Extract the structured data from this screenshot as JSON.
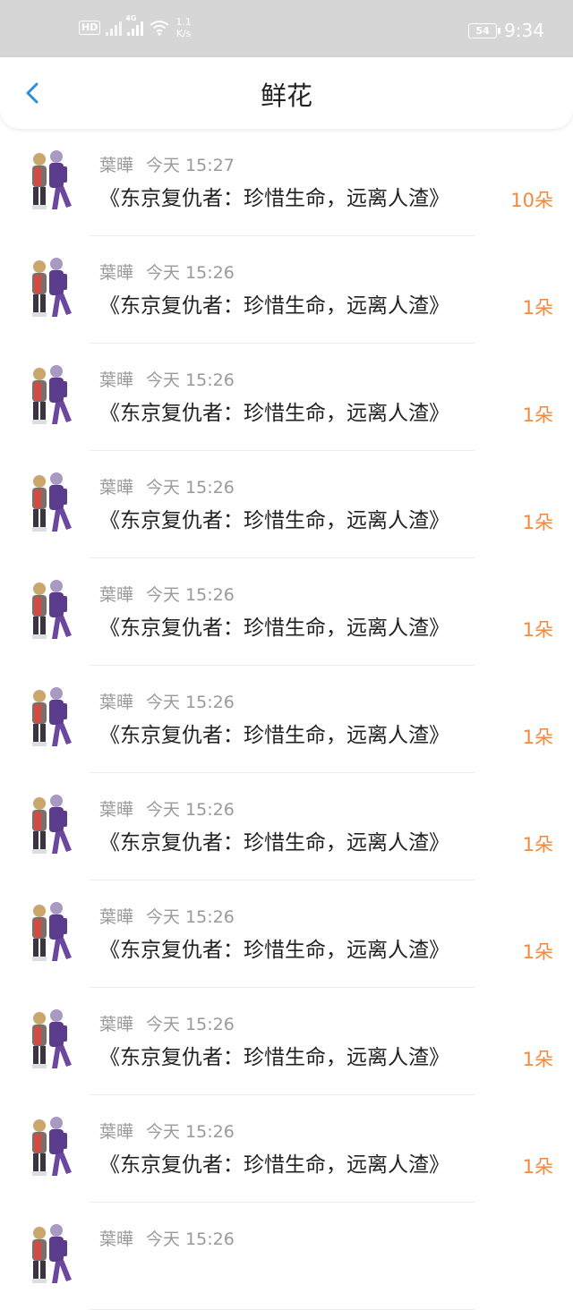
{
  "status_bar": {
    "hd": "HD",
    "network": "4G",
    "speed_value": "1.1",
    "speed_unit": "K/s",
    "battery": "54",
    "time": "9:34"
  },
  "nav": {
    "back_icon": "chevron-left-icon",
    "title": "鲜花"
  },
  "colors": {
    "accent": "#2a8fd8",
    "count": "#f08a3e",
    "meta": "#9a9a9a",
    "status_bar_bg": "#d6d6d6"
  },
  "records": [
    {
      "user": "葉曄",
      "time": "今天 15:27",
      "title": "《东京复仇者：珍惜生命，远离人渣》",
      "count": "10朵"
    },
    {
      "user": "葉曄",
      "time": "今天 15:26",
      "title": "《东京复仇者：珍惜生命，远离人渣》",
      "count": "1朵"
    },
    {
      "user": "葉曄",
      "time": "今天 15:26",
      "title": "《东京复仇者：珍惜生命，远离人渣》",
      "count": "1朵"
    },
    {
      "user": "葉曄",
      "time": "今天 15:26",
      "title": "《东京复仇者：珍惜生命，远离人渣》",
      "count": "1朵"
    },
    {
      "user": "葉曄",
      "time": "今天 15:26",
      "title": "《东京复仇者：珍惜生命，远离人渣》",
      "count": "1朵"
    },
    {
      "user": "葉曄",
      "time": "今天 15:26",
      "title": "《东京复仇者：珍惜生命，远离人渣》",
      "count": "1朵"
    },
    {
      "user": "葉曄",
      "time": "今天 15:26",
      "title": "《东京复仇者：珍惜生命，远离人渣》",
      "count": "1朵"
    },
    {
      "user": "葉曄",
      "time": "今天 15:26",
      "title": "《东京复仇者：珍惜生命，远离人渣》",
      "count": "1朵"
    },
    {
      "user": "葉曄",
      "time": "今天 15:26",
      "title": "《东京复仇者：珍惜生命，远离人渣》",
      "count": "1朵"
    },
    {
      "user": "葉曄",
      "time": "今天 15:26",
      "title": "《东京复仇者：珍惜生命，远离人渣》",
      "count": "1朵"
    },
    {
      "user": "葉曄",
      "time": "今天 15:26",
      "title": "",
      "count": ""
    }
  ]
}
